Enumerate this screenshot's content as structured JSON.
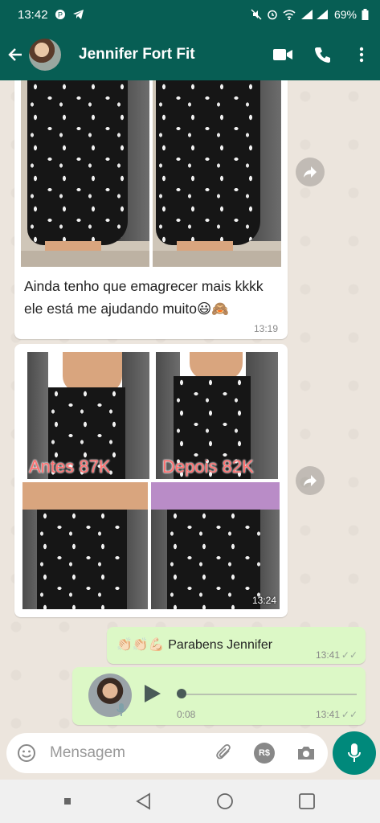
{
  "status_bar": {
    "time": "13:42",
    "battery": "69%"
  },
  "header": {
    "contact_name": "Jennifer Fort Fit"
  },
  "messages": {
    "first": {
      "text_line1": "Ainda tenho que emagrecer mais kkkk",
      "text_line2": "ele está me ajudando muito😃🙈",
      "time": "13:19"
    },
    "collage": {
      "label_before": "Antes 87K",
      "label_after": "Depois 82K",
      "time": "13:24"
    },
    "reply": {
      "text": "👏🏻👏🏻💪🏻 Parabens Jennifer",
      "time": "13:41",
      "ticks": "✓✓"
    },
    "audio": {
      "duration": "0:08",
      "time": "13:41",
      "ticks": "✓✓",
      "progress": 0
    }
  },
  "composer": {
    "placeholder": "Mensagem",
    "currency_label": "R$"
  },
  "colors": {
    "header": "#075e54",
    "outgoing": "#dcf8c6",
    "incoming": "#ffffff",
    "accent": "#00897b"
  }
}
